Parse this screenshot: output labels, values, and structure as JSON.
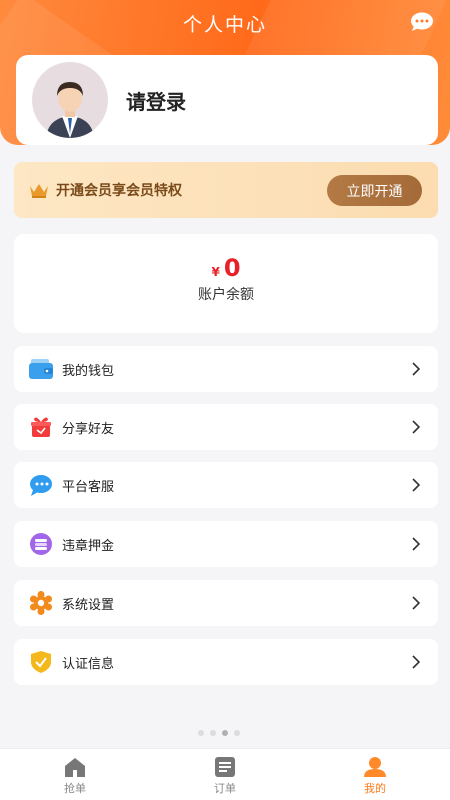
{
  "header": {
    "title": "个人中心",
    "icon": "chat-bubble-icon"
  },
  "profile": {
    "login_text": "请登录",
    "avatar": "avatar-icon"
  },
  "vip": {
    "text": "开通会员享会员特权",
    "button": "立即开通",
    "icon": "crown-icon"
  },
  "balance": {
    "currency": "¥",
    "amount": "0",
    "label": "账户余额",
    "color": "#e8202a"
  },
  "menu": [
    {
      "label": "我的钱包",
      "icon": "wallet-icon"
    },
    {
      "label": "分享好友",
      "icon": "gift-icon"
    },
    {
      "label": "平台客服",
      "icon": "customer-service-icon"
    },
    {
      "label": "违章押金",
      "icon": "deposit-icon"
    },
    {
      "label": "系统设置",
      "icon": "settings-icon"
    },
    {
      "label": "认证信息",
      "icon": "verified-shield-icon"
    }
  ],
  "tabbar": {
    "tabs": [
      {
        "label": "抢单",
        "icon": "home-icon"
      },
      {
        "label": "订单",
        "icon": "order-list-icon"
      },
      {
        "label": "我的",
        "icon": "user-icon",
        "active": true
      }
    ]
  },
  "colors": {
    "accent": "#ff6a1a",
    "vip_button": "#a46a38"
  }
}
